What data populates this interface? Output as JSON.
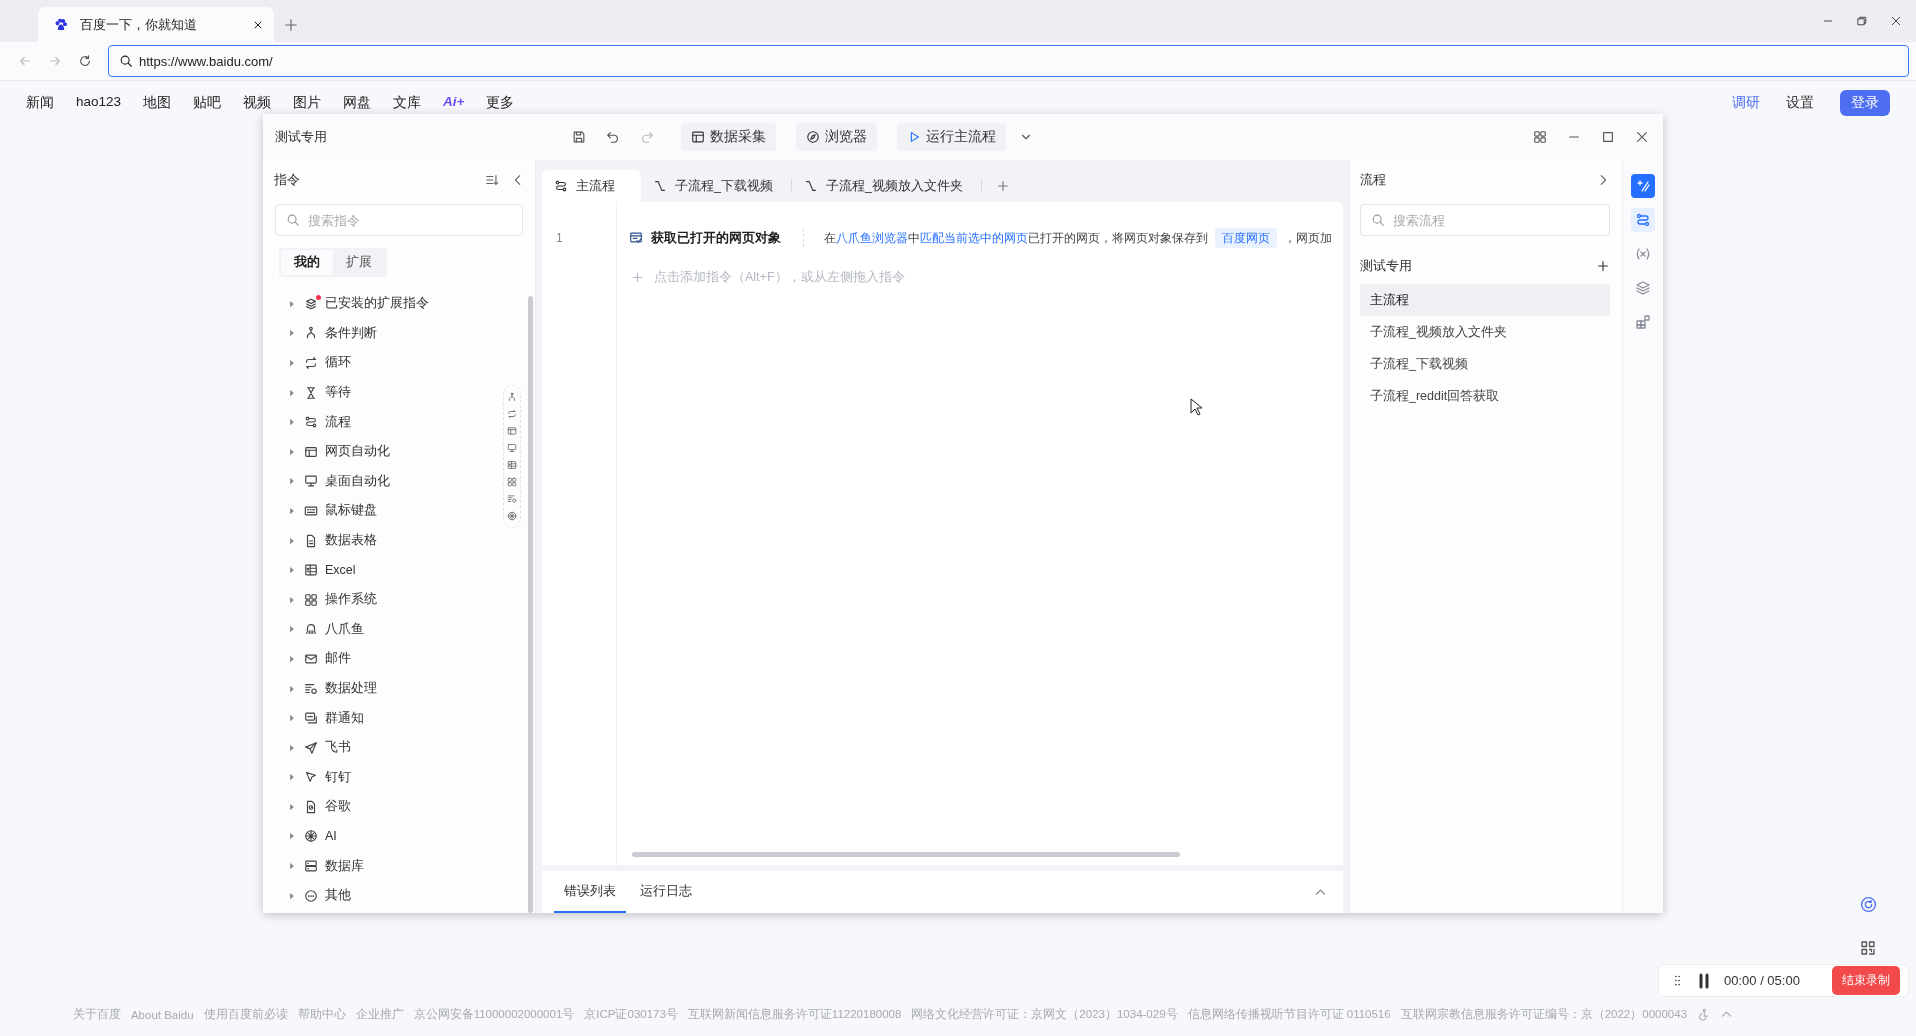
{
  "browser": {
    "tab_title": "百度一下，你就知道",
    "url": "https://www.baidu.com/"
  },
  "baidu_nav": {
    "left": [
      {
        "label": "新闻",
        "kind": "plain"
      },
      {
        "label": "hao123",
        "kind": "plain"
      },
      {
        "label": "地图",
        "kind": "plain"
      },
      {
        "label": "贴吧",
        "kind": "plain"
      },
      {
        "label": "视频",
        "kind": "plain"
      },
      {
        "label": "图片",
        "kind": "plain"
      },
      {
        "label": "网盘",
        "kind": "plain"
      },
      {
        "label": "文库",
        "kind": "plain"
      },
      {
        "label": "Ai+",
        "kind": "ai"
      },
      {
        "label": "更多",
        "kind": "plain"
      }
    ],
    "right": [
      {
        "label": "调研",
        "kind": "link"
      },
      {
        "label": "设置",
        "kind": "plain"
      }
    ],
    "login": "登录"
  },
  "app": {
    "title": "测试专用",
    "toolbar": [
      {
        "label": "数据采集",
        "kind": "collect"
      },
      {
        "label": "浏览器",
        "kind": "browser"
      },
      {
        "label": "运行主流程",
        "kind": "run"
      }
    ],
    "commands": {
      "title": "指令",
      "search_placeholder": "搜索指令",
      "tabs": [
        {
          "label": "我的",
          "selected": true
        },
        {
          "label": "扩展",
          "selected": false
        }
      ],
      "items": [
        {
          "label": "已安装的扩展指令",
          "expanded": false,
          "has_update": true
        },
        {
          "label": "条件判断",
          "expanded": false,
          "has_update": false
        },
        {
          "label": "循环",
          "expanded": false,
          "has_update": false
        },
        {
          "label": "等待",
          "expanded": false,
          "has_update": false
        },
        {
          "label": "流程",
          "expanded": false,
          "has_update": false
        },
        {
          "label": "网页自动化",
          "expanded": false,
          "has_update": false
        },
        {
          "label": "桌面自动化",
          "expanded": false,
          "has_update": false
        },
        {
          "label": "鼠标键盘",
          "expanded": false,
          "has_update": false
        },
        {
          "label": "数据表格",
          "expanded": false,
          "has_update": false
        },
        {
          "label": "Excel",
          "expanded": false,
          "has_update": false
        },
        {
          "label": "操作系统",
          "expanded": false,
          "has_update": false
        },
        {
          "label": "八爪鱼",
          "expanded": false,
          "has_update": false
        },
        {
          "label": "邮件",
          "expanded": false,
          "has_update": false
        },
        {
          "label": "数据处理",
          "expanded": false,
          "has_update": false
        },
        {
          "label": "群通知",
          "expanded": false,
          "has_update": false
        },
        {
          "label": "飞书",
          "expanded": false,
          "has_update": false
        },
        {
          "label": "钉钉",
          "expanded": false,
          "has_update": false
        },
        {
          "label": "谷歌",
          "expanded": false,
          "has_update": false
        },
        {
          "label": "AI",
          "expanded": false,
          "has_update": false
        },
        {
          "label": "数据库",
          "expanded": false,
          "has_update": false
        },
        {
          "label": "其他",
          "expanded": false,
          "has_update": false
        }
      ]
    },
    "editor": {
      "tabs": [
        {
          "label": "主流程",
          "kind": "main",
          "selected": true
        },
        {
          "label": "子流程_下载视频",
          "kind": "sub",
          "selected": false
        },
        {
          "label": "子流程_视频放入文件夹",
          "kind": "sub",
          "selected": false
        }
      ],
      "lines": [
        {
          "number": "1",
          "title": "获取已打开的网页对象",
          "description": [
            {
              "kind": "text",
              "text": "在"
            },
            {
              "kind": "link",
              "text": "八爪鱼浏览器"
            },
            {
              "kind": "text",
              "text": "中"
            },
            {
              "kind": "link",
              "text": "匹配当前选中的网页"
            },
            {
              "kind": "text",
              "text": "已打开的网页，将网页对象保存到"
            },
            {
              "kind": "variable",
              "text": "百度网页"
            },
            {
              "kind": "text",
              "text": "，网页加"
            }
          ]
        }
      ],
      "add_hint": "点击添加指令（Alt+F），或从左侧拖入指令"
    },
    "bottom_tabs": [
      {
        "label": "错误列表",
        "selected": true
      },
      {
        "label": "运行日志",
        "selected": false
      }
    ],
    "flows": {
      "title": "流程",
      "search_placeholder": "搜索流程",
      "group": "测试专用",
      "items": [
        {
          "label": "主流程",
          "selected": true
        },
        {
          "label": "子流程_视频放入文件夹",
          "selected": false
        },
        {
          "label": "子流程_下载视频",
          "selected": false
        },
        {
          "label": "子流程_reddit回答获取",
          "selected": false
        }
      ]
    },
    "side_tools": [
      {
        "kind": "ai",
        "selected": false
      },
      {
        "kind": "flow",
        "selected": true
      },
      {
        "kind": "variable",
        "selected": false
      },
      {
        "kind": "layers",
        "selected": false
      },
      {
        "kind": "widgets",
        "selected": false
      }
    ]
  },
  "recorder": {
    "time": "00:00 / 05:00",
    "stop": "结束录制"
  },
  "footer": [
    "关于百度",
    "About Baidu",
    "使用百度前必读",
    "帮助中心",
    "企业推广",
    "京公网安备11000002000001号",
    "京ICP证030173号",
    "互联网新闻信息服务许可证11220180008",
    "网络文化经营许可证：京网文（2023）1034-029号",
    "信息网络传播视听节目许可证 0110516",
    "互联网宗教信息服务许可证编号：京（2022）0000043"
  ]
}
